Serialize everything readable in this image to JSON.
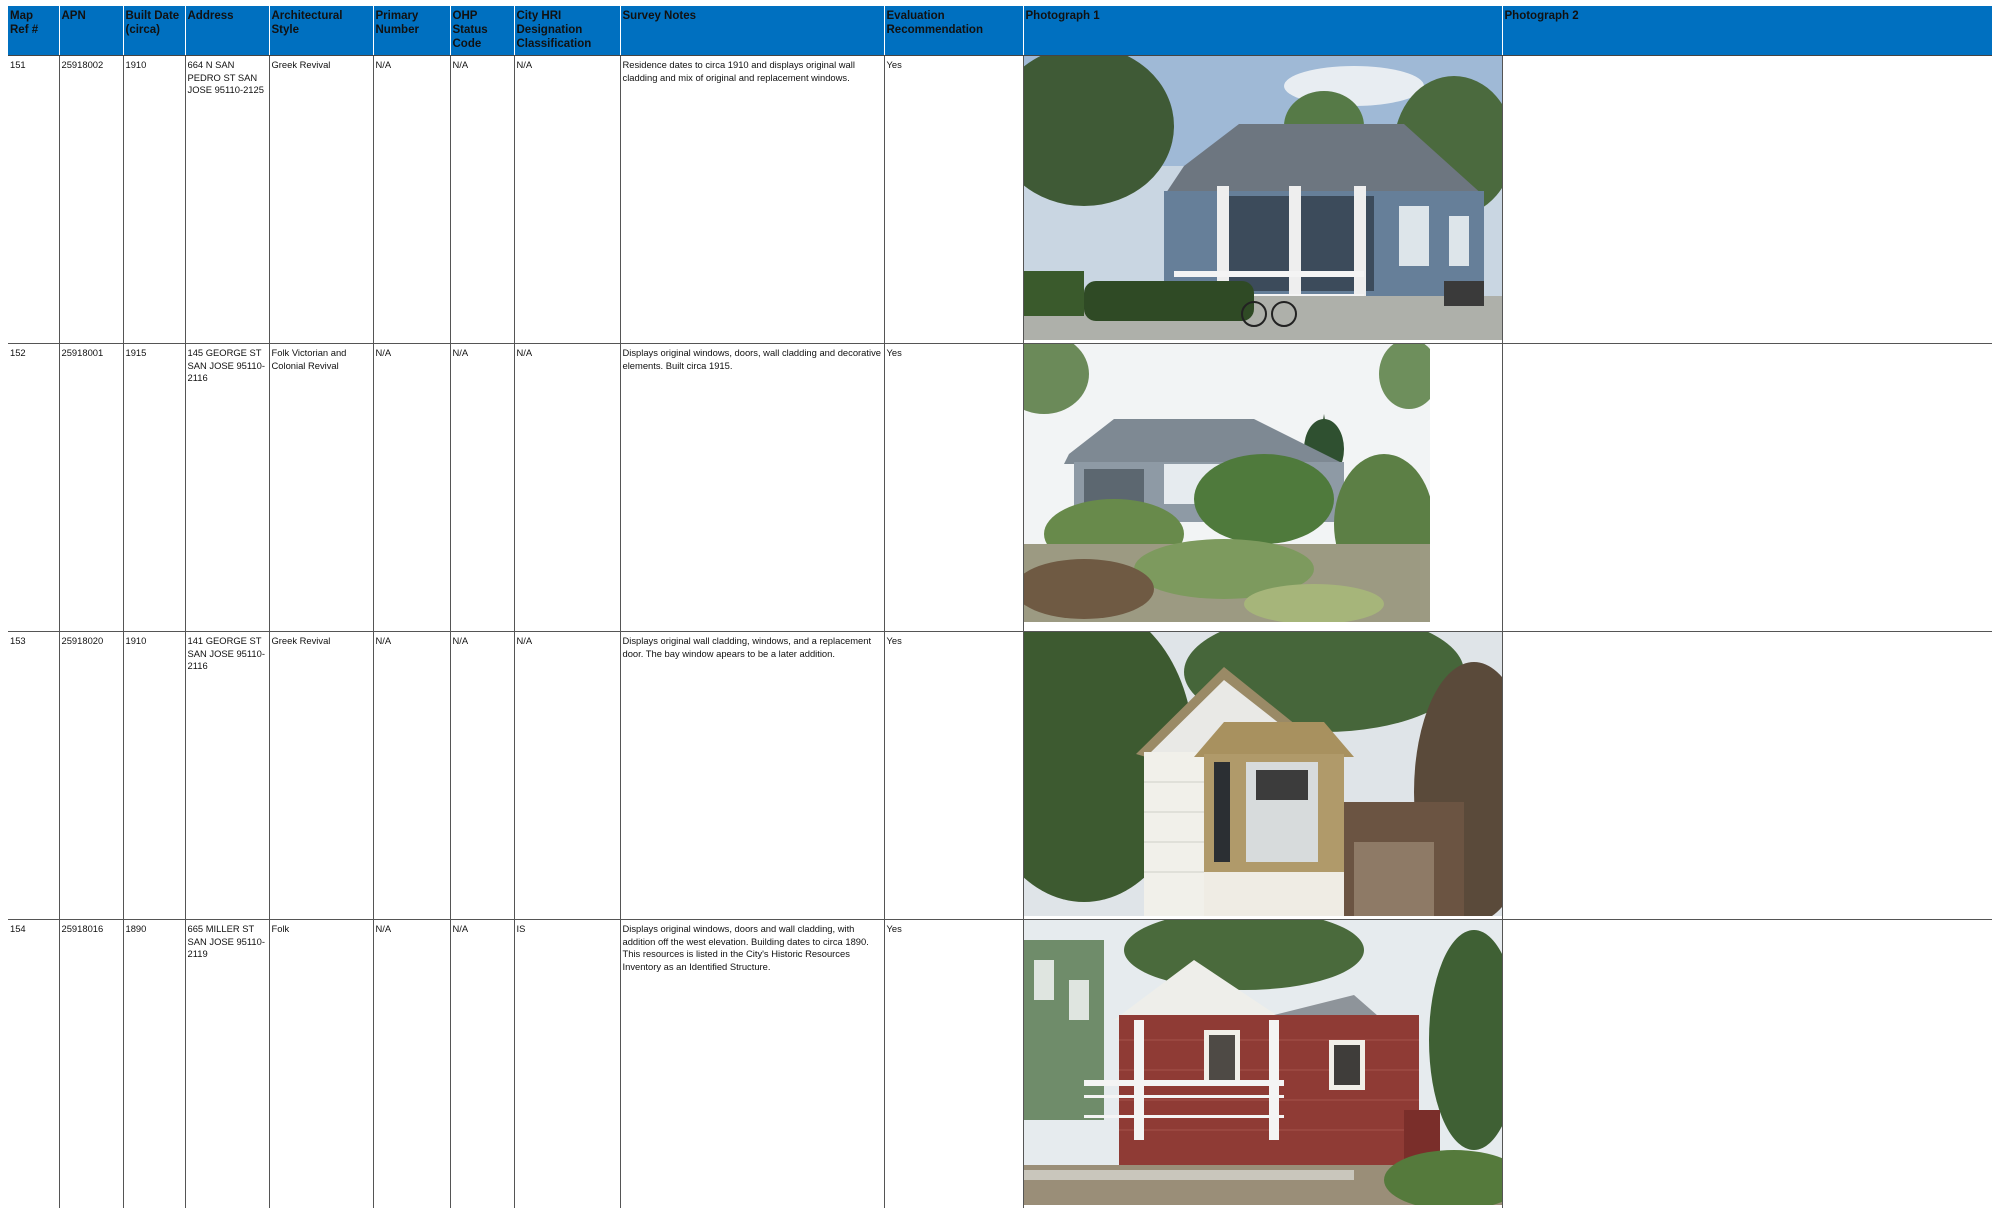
{
  "table": {
    "headers": {
      "map_ref": "Map\nRef #",
      "apn": "APN",
      "built_date": "Built Date\n(circa)",
      "address": "Address",
      "arch_style": "Architectural\nStyle",
      "primary_number": "Primary\nNumber",
      "ohp_code": "OHP\nStatus\nCode",
      "city_hri": "City HRI\nDesignation\nClassification",
      "survey_notes": "Survey Notes",
      "evaluation": "Evaluation\nRecommendation",
      "photo1": "Photograph 1",
      "photo2": "Photograph 2"
    },
    "rows": [
      {
        "map_ref": "151",
        "apn": "25918002",
        "built_date": "1910",
        "address": "664 N SAN PEDRO ST SAN JOSE 95110-2125",
        "arch_style": "Greek Revival",
        "primary_number": "N/A",
        "ohp_code": "N/A",
        "city_hri": "N/A",
        "survey_notes": "Residence dates to circa 1910 and displays original wall cladding and mix of original and replacement windows.",
        "evaluation": "Yes",
        "photo_icon": "house-photo-blue-craftsman"
      },
      {
        "map_ref": "152",
        "apn": "25918001",
        "built_date": "1915",
        "address": "145 GEORGE ST SAN JOSE 95110-2116",
        "arch_style": "Folk Victorian and Colonial Revival",
        "primary_number": "N/A",
        "ohp_code": "N/A",
        "city_hri": "N/A",
        "survey_notes": "Displays original windows, doors, wall cladding and decorative elements. Built circa 1915.",
        "evaluation": "Yes",
        "photo_icon": "house-photo-gray-garden"
      },
      {
        "map_ref": "153",
        "apn": "25918020",
        "built_date": "1910",
        "address": "141 GEORGE ST SAN JOSE 95110-2116",
        "arch_style": "Greek Revival",
        "primary_number": "N/A",
        "ohp_code": "N/A",
        "city_hri": "N/A",
        "survey_notes": "Displays original wall cladding, windows, and a replacement door. The bay window apears to be a later addition.",
        "evaluation": "Yes",
        "photo_icon": "house-photo-white-bay-window"
      },
      {
        "map_ref": "154",
        "apn": "25918016",
        "built_date": "1890",
        "address": "665 MILLER ST SAN JOSE 95110-2119",
        "arch_style": "Folk",
        "primary_number": "N/A",
        "ohp_code": "N/A",
        "city_hri": "IS",
        "survey_notes": "Displays original windows, doors and wall cladding, with addition off the west elevation. Building dates to circa 1890. This resources is listed in the City's Historic Resources Inventory as an Identified Structure.",
        "evaluation": "Yes",
        "photo_icon": "house-photo-red-porch"
      }
    ]
  },
  "colors": {
    "header_bg": "#0070c0",
    "grid": "#555555"
  }
}
